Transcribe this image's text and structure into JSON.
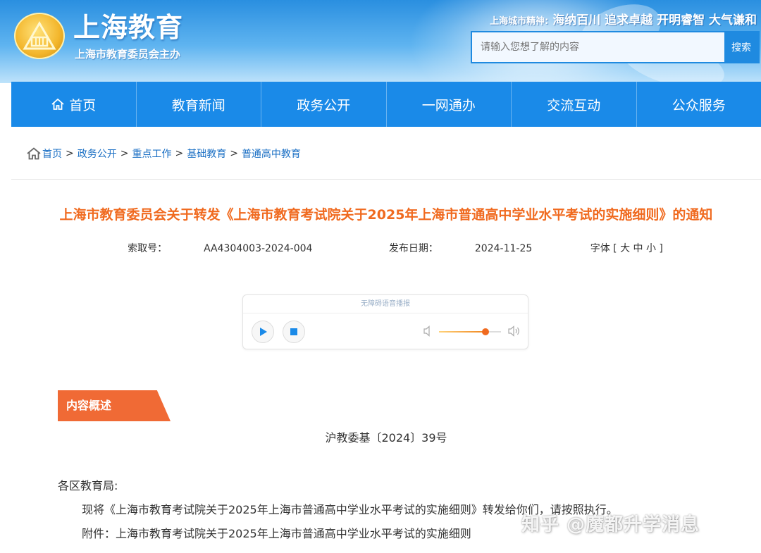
{
  "header": {
    "site_title": "上海教育",
    "site_subtitle": "上海市教育委员会主办",
    "spirit_label": "上海城市精神:",
    "spirit_text": "海纳百川 追求卓越 开明睿智 大气谦和",
    "search_placeholder": "请输入您想了解的内容",
    "search_button": "搜索"
  },
  "nav": {
    "items": [
      {
        "label": "首页",
        "icon": "home-icon"
      },
      {
        "label": "教育新闻"
      },
      {
        "label": "政务公开"
      },
      {
        "label": "一网通办"
      },
      {
        "label": "交流互动"
      },
      {
        "label": "公众服务"
      }
    ]
  },
  "breadcrumb": {
    "icon": "home-icon",
    "items": [
      "首页",
      "政务公开",
      "重点工作",
      "基础教育",
      "普通高中教育"
    ],
    "separator": ">"
  },
  "article": {
    "title": "上海市教育委员会关于转发《上海市教育考试院关于2025年上海市普通高中学业水平考试的实施细则》的通知",
    "index_label": "索取号：",
    "index_value": "AA4304003-2024-004",
    "date_label": "发布日期：",
    "date_value": "2024-11-25",
    "font_size_label": "字体 [ 大 中 小 ]",
    "summary_tag": "内容概述",
    "doc_number": "沪教委基〔2024〕39号",
    "salutation": "各区教育局:",
    "paragraph1": "现将《上海市教育考试院关于2025年上海市普通高中学业水平考试的实施细则》转发给你们，请按照执行。",
    "paragraph2": "附件：上海市教育考试院关于2025年上海市普通高中学业水平考试的实施细则"
  },
  "player": {
    "title": "无障碍语音播报",
    "volume": 0.75
  },
  "watermark": "知乎 @魔都升学消息",
  "colors": {
    "nav_bg": "#1a8ae8",
    "title_orange": "#f06a1f",
    "summary_tag": "#f06a35",
    "link_blue": "#1a6fc4"
  }
}
